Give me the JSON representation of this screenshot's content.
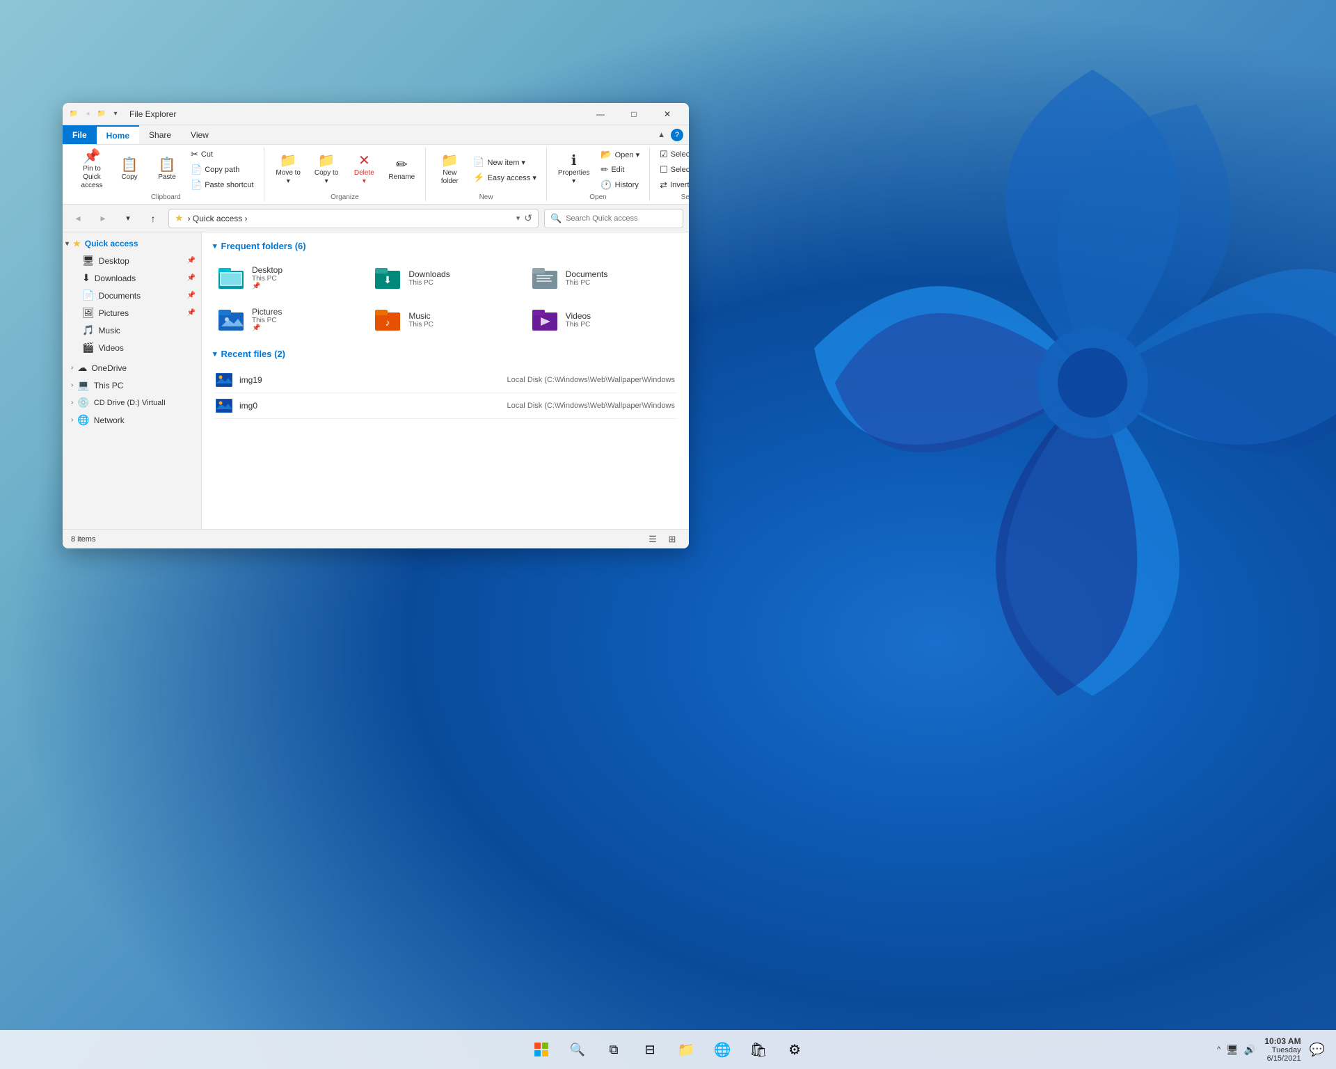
{
  "window": {
    "title": "File Explorer",
    "titlebar_icons": [
      "📁",
      "↩",
      "📁"
    ],
    "minimize": "—",
    "maximize": "□",
    "close": "✕"
  },
  "ribbon": {
    "tabs": [
      "File",
      "Home",
      "Share",
      "View"
    ],
    "active_tab": "Home",
    "groups": {
      "clipboard": {
        "label": "Clipboard",
        "buttons": [
          {
            "id": "pin-to-quick",
            "icon": "📌",
            "label": "Pin to Quick\naccess"
          },
          {
            "id": "copy",
            "icon": "📋",
            "label": "Copy"
          },
          {
            "id": "paste",
            "icon": "📋",
            "label": "Paste"
          },
          {
            "id": "cut",
            "icon": "✂",
            "label": "Cut"
          },
          {
            "id": "copy-path",
            "icon": "📄",
            "label": "Copy path"
          },
          {
            "id": "paste-shortcut",
            "icon": "📄",
            "label": "Paste shortcut"
          }
        ]
      },
      "organize": {
        "label": "Organize",
        "buttons": [
          {
            "id": "move-to",
            "icon": "📁",
            "label": "Move to"
          },
          {
            "id": "copy-to",
            "icon": "📁",
            "label": "Copy to"
          },
          {
            "id": "delete",
            "icon": "✕",
            "label": "Delete"
          },
          {
            "id": "rename",
            "icon": "✏",
            "label": "Rename"
          }
        ]
      },
      "new": {
        "label": "New",
        "buttons": [
          {
            "id": "new-folder",
            "icon": "📁",
            "label": "New folder"
          },
          {
            "id": "new-item",
            "icon": "📄",
            "label": "New item"
          },
          {
            "id": "easy-access",
            "icon": "⚡",
            "label": "Easy access"
          }
        ]
      },
      "open": {
        "label": "Open",
        "buttons": [
          {
            "id": "properties",
            "icon": "ℹ",
            "label": "Properties"
          },
          {
            "id": "open",
            "icon": "📂",
            "label": "Open"
          },
          {
            "id": "edit",
            "icon": "✏",
            "label": "Edit"
          },
          {
            "id": "history",
            "icon": "🕐",
            "label": "History"
          }
        ]
      },
      "select": {
        "label": "Select",
        "buttons": [
          {
            "id": "select-all",
            "icon": "☑",
            "label": "Select all"
          },
          {
            "id": "select-none",
            "icon": "☐",
            "label": "Select none"
          },
          {
            "id": "invert-selection",
            "icon": "⇄",
            "label": "Invert selection"
          }
        ]
      }
    }
  },
  "addressbar": {
    "back_title": "Back",
    "forward_title": "Forward",
    "up_title": "Up",
    "star_icon": "★",
    "path_parts": [
      "Quick access"
    ],
    "search_placeholder": "Search Quick access"
  },
  "sidebar": {
    "quick_access_label": "Quick access",
    "items": [
      {
        "id": "desktop",
        "label": "Desktop",
        "icon": "🖥",
        "pinned": true
      },
      {
        "id": "downloads",
        "label": "Downloads",
        "icon": "⬇",
        "pinned": true
      },
      {
        "id": "documents",
        "label": "Documents",
        "icon": "📄",
        "pinned": true
      },
      {
        "id": "pictures",
        "label": "Pictures",
        "icon": "🖼",
        "pinned": true
      },
      {
        "id": "music",
        "label": "Music",
        "icon": "🎵",
        "pinned": false
      },
      {
        "id": "videos",
        "label": "Videos",
        "icon": "🎬",
        "pinned": false
      }
    ],
    "tree_items": [
      {
        "id": "onedrive",
        "label": "OneDrive",
        "icon": "☁",
        "expandable": true
      },
      {
        "id": "this-pc",
        "label": "This PC",
        "icon": "💻",
        "expandable": true
      },
      {
        "id": "cd-drive",
        "label": "CD Drive (D:) VirtualI",
        "icon": "💿",
        "expandable": true
      },
      {
        "id": "network",
        "label": "Network",
        "icon": "🌐",
        "expandable": true
      }
    ]
  },
  "content": {
    "frequent_folders_header": "Frequent folders (6)",
    "frequent_folders": [
      {
        "id": "desktop",
        "name": "Desktop",
        "sub": "This PC",
        "pinned": true,
        "color": "teal"
      },
      {
        "id": "downloads",
        "name": "Downloads",
        "sub": "This PC",
        "pinned": false,
        "color": "green"
      },
      {
        "id": "documents",
        "name": "Documents",
        "sub": "This PC",
        "pinned": false,
        "color": "gray"
      },
      {
        "id": "pictures",
        "name": "Pictures",
        "sub": "This PC",
        "pinned": true,
        "color": "blue"
      },
      {
        "id": "music",
        "name": "Music",
        "sub": "This PC",
        "pinned": false,
        "color": "orange"
      },
      {
        "id": "videos",
        "name": "Videos",
        "sub": "This PC",
        "pinned": false,
        "color": "purple"
      }
    ],
    "recent_files_header": "Recent files (2)",
    "recent_files": [
      {
        "id": "img19",
        "name": "img19",
        "path": "Local Disk (C:)\\Windows\\Web\\Wallpaper\\Windows"
      },
      {
        "id": "img0",
        "name": "img0",
        "path": "Local Disk (C:)\\Windows\\Web\\Wallpaper\\Windows"
      }
    ]
  },
  "statusbar": {
    "item_count": "8 items",
    "detail_view_icon": "☰",
    "large_icon_view_icon": "⊞"
  },
  "taskbar": {
    "start_icon": "⊞",
    "search_icon": "🔍",
    "task_view_icon": "⧉",
    "widgets_icon": "⊟",
    "file_explorer_icon": "📁",
    "edge_icon": "🌐",
    "store_icon": "🛍",
    "settings_icon": "⚙",
    "sys_icons": [
      "^",
      "🖥",
      "🔊"
    ],
    "time": "10:03 AM",
    "date": "Tuesday\n6/15/2021",
    "notification_icon": "💬"
  }
}
